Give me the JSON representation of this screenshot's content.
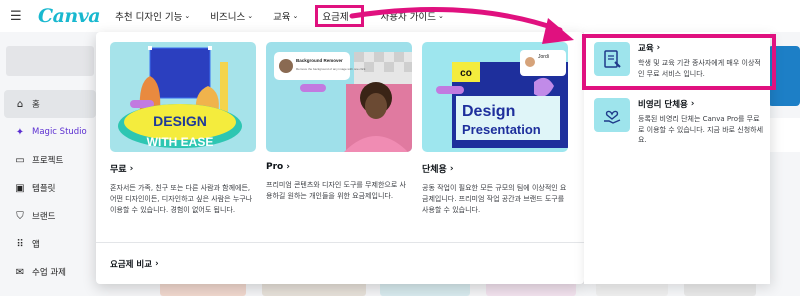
{
  "header": {
    "logo": "Canva",
    "nav": [
      {
        "label": "추천 디자인 기능"
      },
      {
        "label": "비즈니스"
      },
      {
        "label": "교육"
      },
      {
        "label": "요금제"
      },
      {
        "label": "사용자 가이드"
      }
    ]
  },
  "sidebar": {
    "items": [
      {
        "label": "홈",
        "icon": "home-icon"
      },
      {
        "label": "Magic Studio",
        "icon": "sparkle-icon"
      },
      {
        "label": "프로젝트",
        "icon": "folder-icon"
      },
      {
        "label": "템플릿",
        "icon": "template-icon"
      },
      {
        "label": "브랜드",
        "icon": "brand-icon"
      },
      {
        "label": "앱",
        "icon": "apps-grid-icon"
      },
      {
        "label": "수업 과제",
        "icon": "assignment-icon"
      }
    ]
  },
  "dropdown": {
    "cards": [
      {
        "title": "무료",
        "desc": "혼자서든 가족, 친구 또는 다른 사람과 함께에든, 어떤 디자인이든, 디자인하고 싶은 사람은 누구나 이용할 수 있습니다. 경험이 없어도 됩니다.",
        "img_text_1": "DESIGN",
        "img_text_2": "WITH EASE"
      },
      {
        "title": "Pro",
        "desc": "프리미엄 콘텐츠와 디자인 도구를 무제한으로 사용하길 원하는 개인들을 위한 요금제입니다.",
        "img_text_1": "Background Remover",
        "img_text_2": "Remove the background of any image with one click"
      },
      {
        "title": "단체용",
        "desc": "공동 작업이 필요한 모든 규모의 팀에 이상적인 요금제입니다. 프리미엄 작업 공간과 브랜드 도구를 사용할 수 있습니다.",
        "img_text_1": "Design",
        "img_text_2": "Presentation",
        "img_text_3": "Jordi"
      }
    ],
    "compare_label": "요금제 비교"
  },
  "right_panel": {
    "items": [
      {
        "title": "교육",
        "desc": "학생 및 교육 기관 종사자에게 매우 이상적인 무료 서비스 입니다."
      },
      {
        "title": "비영리 단체용",
        "desc": "등록된 비영리 단체는 Canva Pro를 무료로 이용할 수 있습니다. 지금 바로 신청하세요."
      }
    ]
  },
  "colors": {
    "highlight": "#e0117f",
    "brand": "#19b8cf",
    "tile": "#9ee4ec"
  }
}
